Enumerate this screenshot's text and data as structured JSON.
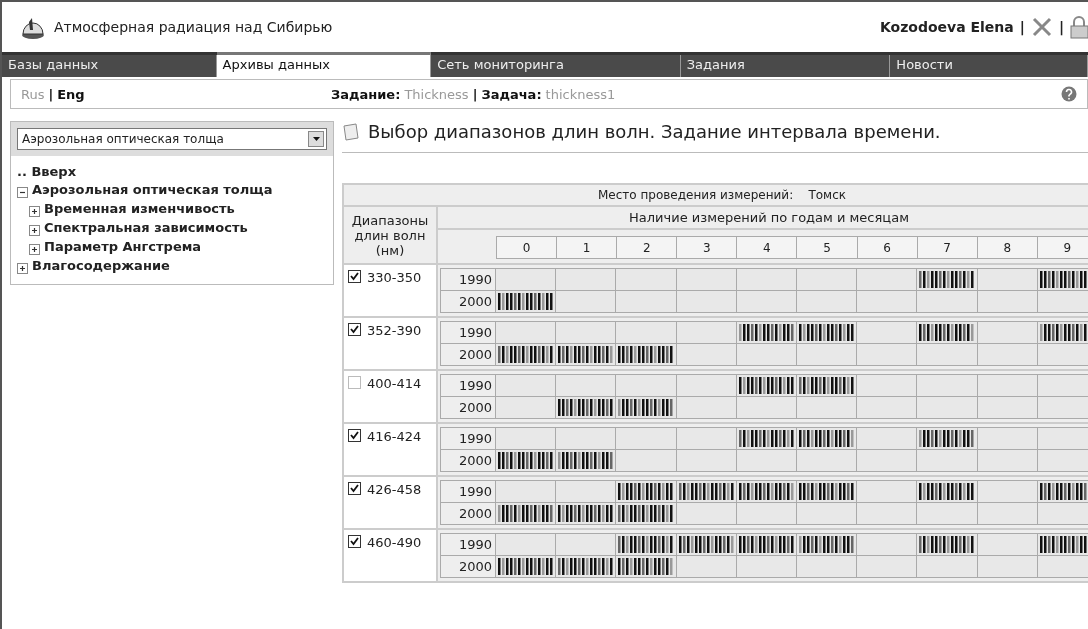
{
  "header": {
    "title": "Атмосферная радиация над Сибирью",
    "user": "Kozodoeva Elena",
    "separators": [
      "|",
      "|"
    ]
  },
  "tabs": [
    {
      "label": "Базы данных",
      "selected": false
    },
    {
      "label": "Архивы данных",
      "selected": true
    },
    {
      "label": "Сеть мониторинга",
      "selected": false
    },
    {
      "label": "Задания",
      "selected": false
    },
    {
      "label": "Новости",
      "selected": false
    }
  ],
  "languages": [
    {
      "label": "Rus",
      "selected": false
    },
    {
      "label": "Eng",
      "selected": true
    }
  ],
  "language_separator": "|",
  "task": {
    "task_label": "Задание:",
    "task_value": "Thickness",
    "separator": "|",
    "subtask_label": "Задача:",
    "subtask_value": "thickness1"
  },
  "sidebar": {
    "dropdown": {
      "value": "Аэрозольная оптическая толща"
    },
    "up_link": ".. Вверх",
    "tree": [
      {
        "label": "Аэрозольная оптическая толща",
        "expanded": true,
        "children": [
          {
            "label": "Временная изменчивость",
            "expanded": false
          },
          {
            "label": "Спектральная зависимость",
            "expanded": false
          },
          {
            "label": "Параметр Ангстрема",
            "expanded": false
          }
        ]
      },
      {
        "label": "Влагосодержание",
        "expanded": false
      }
    ]
  },
  "content": {
    "title": "Выбор диапазонов длин волн. Задание интервала времени.",
    "table": {
      "place_label": "Место проведения измерений:",
      "place_value": "Томск",
      "range_header": "Диапазоны длин волн (нм)",
      "availability_header": "Наличие измерений по годам и месяцам",
      "columns": [
        "0",
        "1",
        "2",
        "3",
        "4",
        "5",
        "6",
        "7",
        "8",
        "9"
      ],
      "rows": [
        {
          "range": "330-350",
          "checked": true,
          "years": [
            {
              "label": "1990",
              "data": [
                false,
                false,
                false,
                false,
                false,
                false,
                false,
                true,
                false,
                true
              ]
            },
            {
              "label": "2000",
              "data": [
                true,
                false,
                false,
                false,
                false,
                false,
                false,
                false,
                false,
                false
              ]
            }
          ]
        },
        {
          "range": "352-390",
          "checked": true,
          "years": [
            {
              "label": "1990",
              "data": [
                false,
                false,
                false,
                false,
                true,
                true,
                false,
                true,
                false,
                true
              ]
            },
            {
              "label": "2000",
              "data": [
                true,
                true,
                true,
                false,
                false,
                false,
                false,
                false,
                false,
                false
              ]
            }
          ]
        },
        {
          "range": "400-414",
          "checked": false,
          "years": [
            {
              "label": "1990",
              "data": [
                false,
                false,
                false,
                false,
                true,
                true,
                false,
                false,
                false,
                false
              ]
            },
            {
              "label": "2000",
              "data": [
                false,
                true,
                true,
                false,
                false,
                false,
                false,
                false,
                false,
                false
              ]
            }
          ]
        },
        {
          "range": "416-424",
          "checked": true,
          "years": [
            {
              "label": "1990",
              "data": [
                false,
                false,
                false,
                false,
                true,
                true,
                false,
                true,
                false,
                false
              ]
            },
            {
              "label": "2000",
              "data": [
                true,
                true,
                false,
                false,
                false,
                false,
                false,
                false,
                false,
                false
              ]
            }
          ]
        },
        {
          "range": "426-458",
          "checked": true,
          "years": [
            {
              "label": "1990",
              "data": [
                false,
                false,
                true,
                true,
                true,
                true,
                false,
                true,
                false,
                true
              ]
            },
            {
              "label": "2000",
              "data": [
                true,
                true,
                true,
                false,
                false,
                false,
                false,
                false,
                false,
                false
              ]
            }
          ]
        },
        {
          "range": "460-490",
          "checked": true,
          "years": [
            {
              "label": "1990",
              "data": [
                false,
                false,
                true,
                true,
                true,
                true,
                false,
                true,
                false,
                true
              ]
            },
            {
              "label": "2000",
              "data": [
                true,
                true,
                true,
                false,
                false,
                false,
                false,
                false,
                false,
                false
              ]
            }
          ]
        }
      ]
    }
  }
}
